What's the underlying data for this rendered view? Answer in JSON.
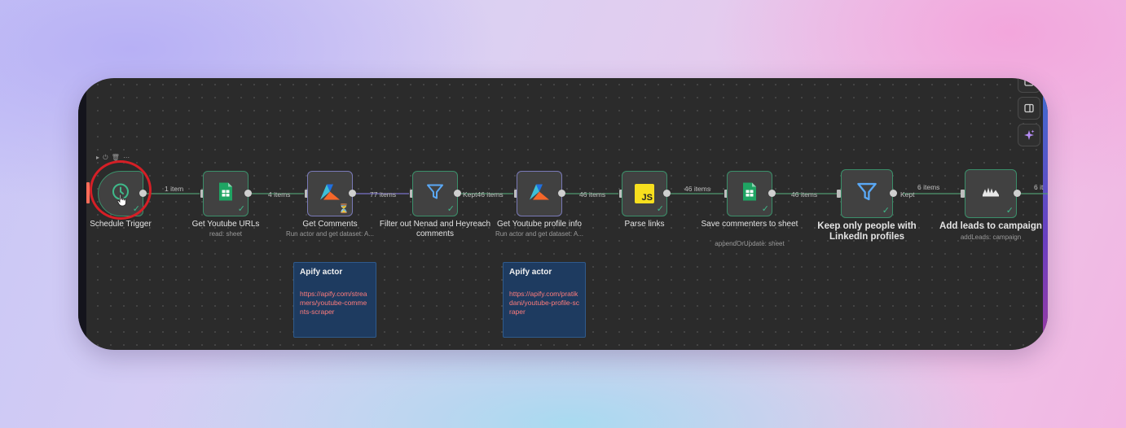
{
  "canvas": {
    "toolbar_icons": [
      "fit-view-icon",
      "panel-toggle-icon",
      "ai-sparkle-icon"
    ],
    "trigger_toolbar_icons": "▸ ⏻ 🗑 ⋯"
  },
  "nodes": [
    {
      "name": "Schedule Trigger",
      "subtitle": "",
      "icon": "clock-icon",
      "status": "success"
    },
    {
      "name": "Get Youtube URLs",
      "subtitle": "read: sheet",
      "icon": "google-sheets-icon",
      "status": "success"
    },
    {
      "name": "Get Comments",
      "subtitle": "Run actor and get dataset: A...",
      "icon": "apify-icon",
      "status": "pending"
    },
    {
      "name": "Filter out Nenad and Heyreach comments",
      "subtitle": "",
      "icon": "filter-icon",
      "status": "success"
    },
    {
      "name": "Get Youtube profile info",
      "subtitle": "Run actor and get dataset: A...",
      "icon": "apify-icon",
      "status": "pending"
    },
    {
      "name": "Parse links",
      "subtitle": "",
      "icon": "javascript-icon",
      "status": "success"
    },
    {
      "name": "Save commenters to sheet",
      "subtitle": "appendOrUpdate: sheet",
      "icon": "google-sheets-icon",
      "status": "success"
    },
    {
      "name": "Keep only people with LinkedIn profiles",
      "subtitle": "",
      "icon": "filter-icon",
      "status": "success"
    },
    {
      "name": "Add leads to campaign",
      "subtitle": "addLeads: campaign",
      "icon": "heyreach-icon",
      "status": "success"
    }
  ],
  "connections": [
    "1 item",
    "4 items",
    "77 items",
    "Kept46 items",
    "46 items",
    "46 items",
    "46 items",
    "Kept",
    "6 items",
    "6 it"
  ],
  "icon_text": {
    "javascript": "JS"
  },
  "notes": [
    {
      "title": "Apify actor",
      "link": "https://apify.com/streamers/youtube-comments-scraper"
    },
    {
      "title": "Apify actor",
      "link": "https://apify.com/pratikdani/youtube-profile-scraper"
    }
  ],
  "colors": {
    "canvas_bg": "#2b2b2b",
    "success_border": "#3b8f6a",
    "note_bg": "#1e3b60",
    "link": "#ff7c7c",
    "highlight_ring": "#d51f26"
  }
}
